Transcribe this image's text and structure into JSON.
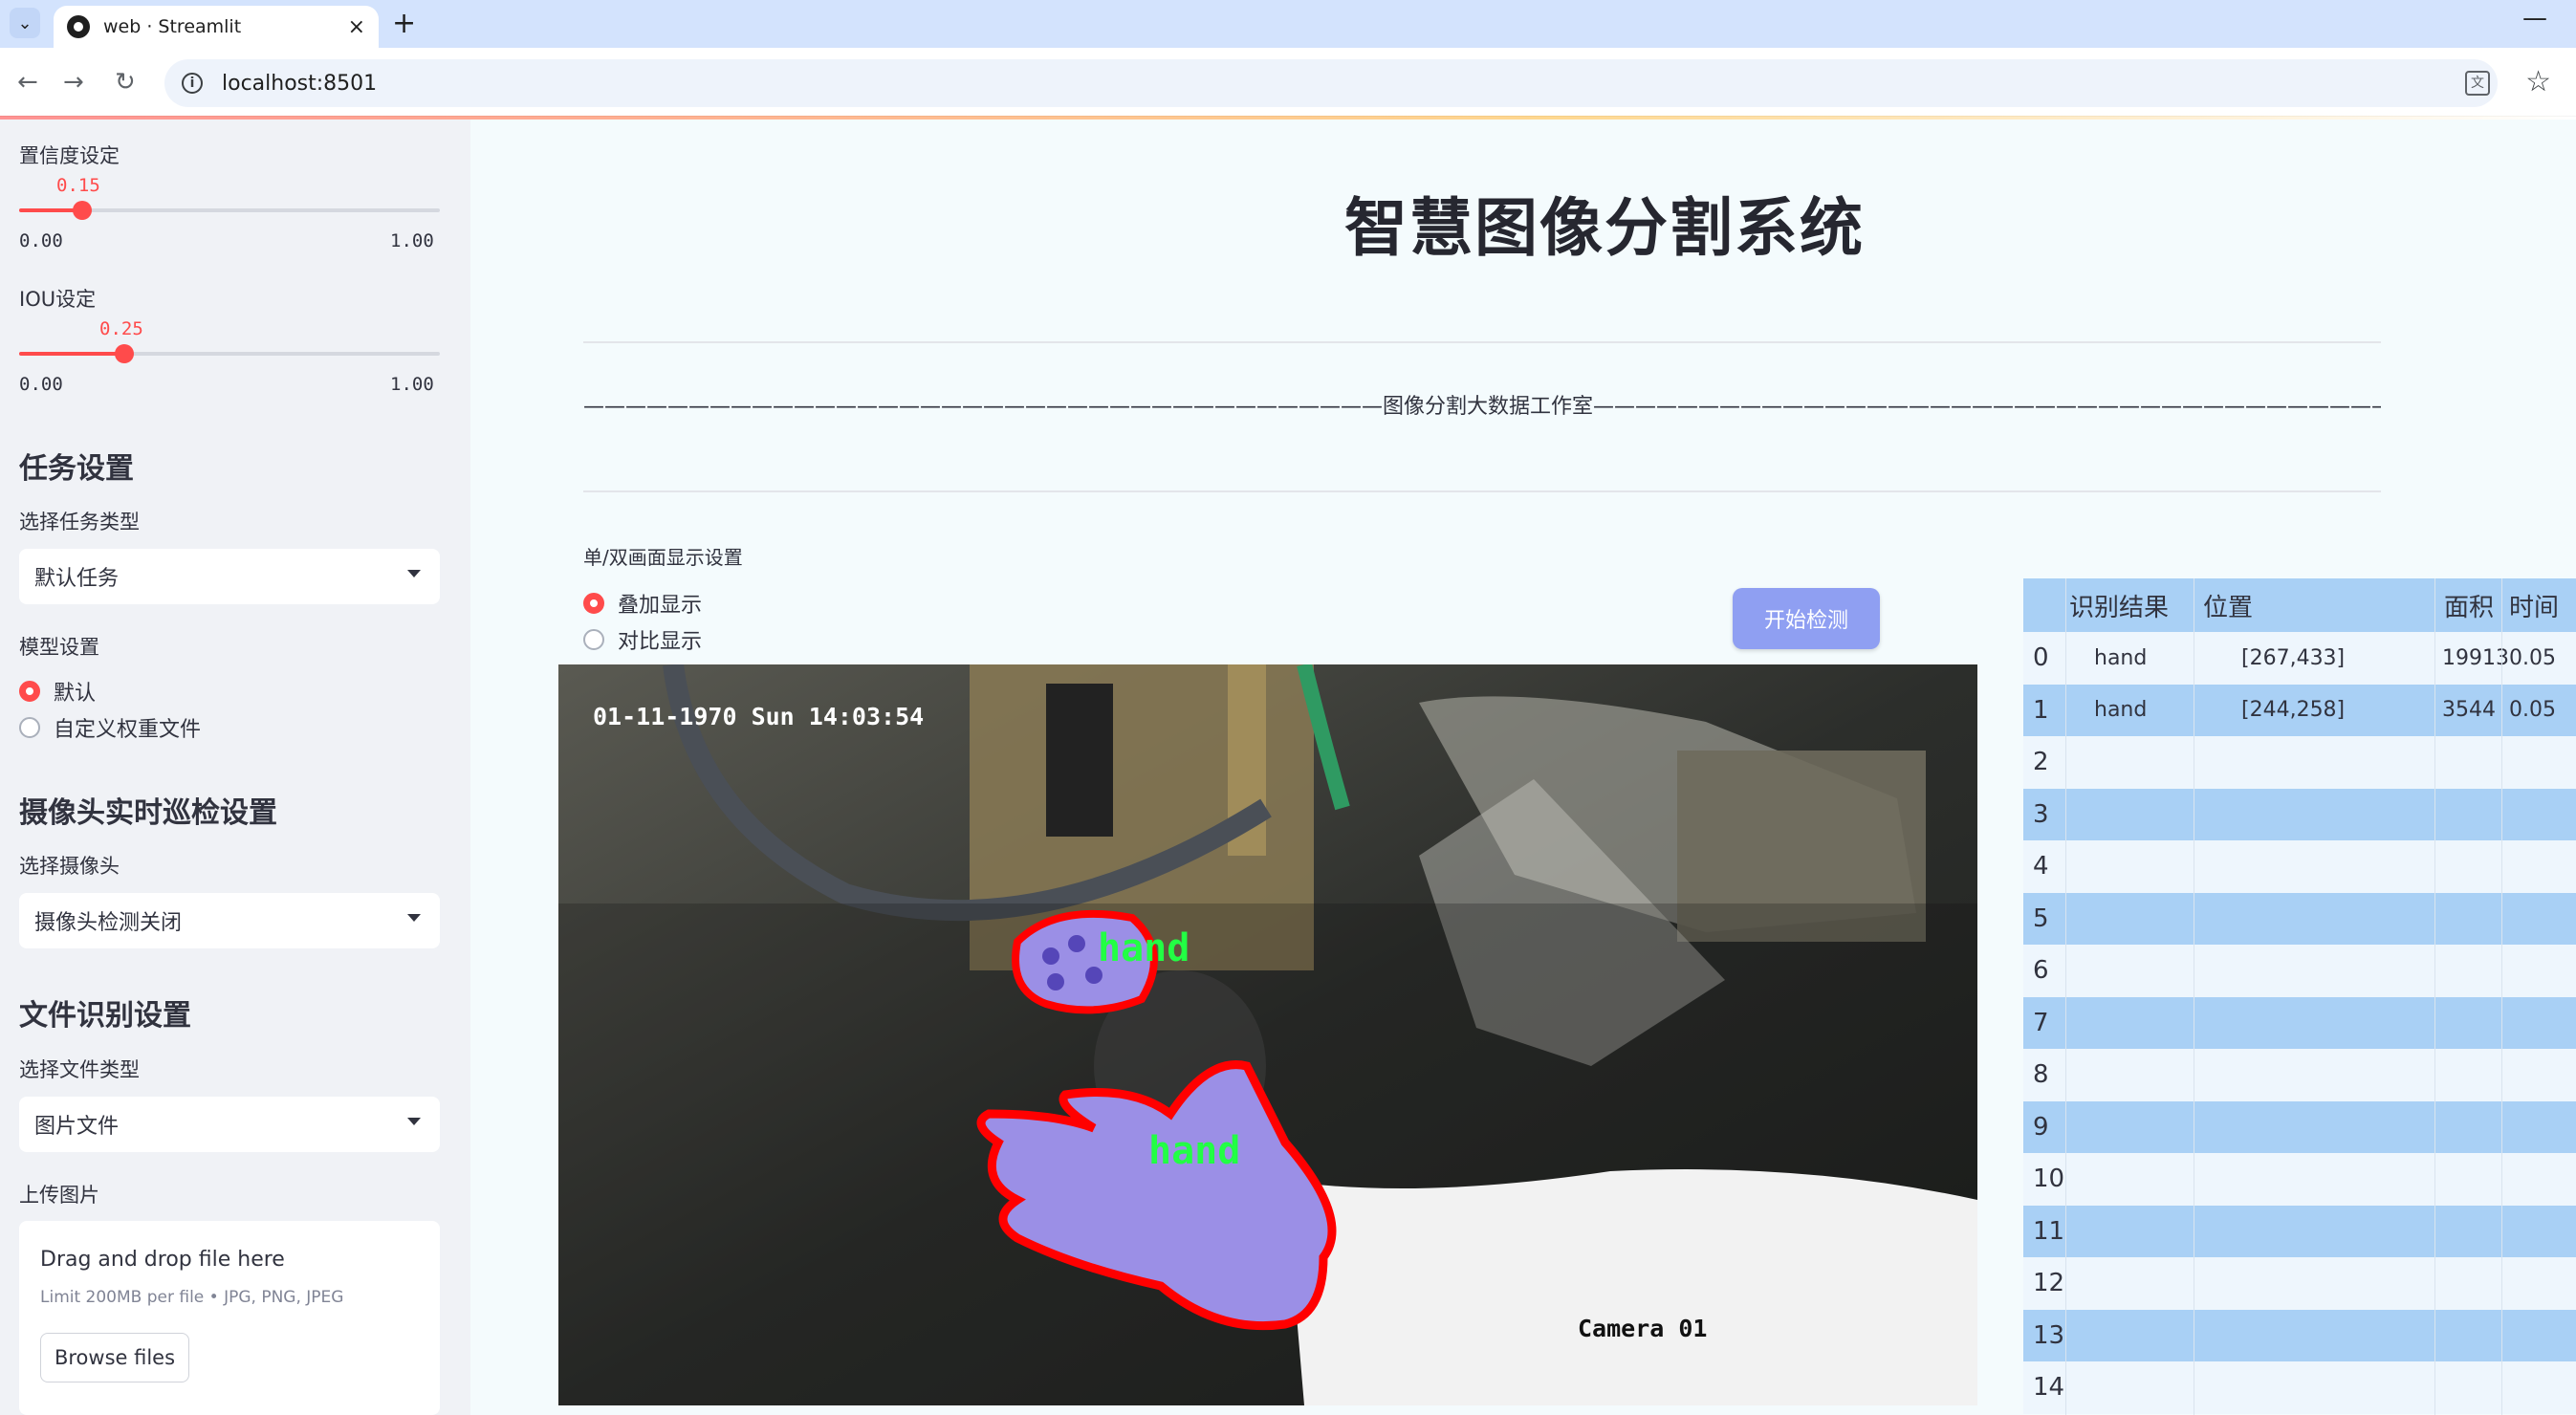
{
  "browser": {
    "tab_title": "web · Streamlit",
    "url": "localhost:8501"
  },
  "sidebar": {
    "confidence": {
      "label": "置信度设定",
      "value": "0.15",
      "min": "0.00",
      "max": "1.00",
      "fraction": 0.15
    },
    "iou": {
      "label": "IOU设定",
      "value": "0.25",
      "min": "0.00",
      "max": "1.00",
      "fraction": 0.25
    },
    "task_heading": "任务设置",
    "task_type_label": "选择任务类型",
    "task_type_value": "默认任务",
    "model_label": "模型设置",
    "model_options": [
      "默认",
      "自定义权重文件"
    ],
    "model_selected": 0,
    "camera_heading": "摄像头实时巡检设置",
    "camera_label": "选择摄像头",
    "camera_value": "摄像头检测关闭",
    "file_heading": "文件识别设置",
    "file_type_label": "选择文件类型",
    "file_type_value": "图片文件",
    "upload_label": "上传图片",
    "uploader": {
      "title": "Drag and drop file here",
      "limit": "Limit 200MB per file • JPG, PNG, JPEG",
      "button": "Browse files"
    }
  },
  "main": {
    "title": "智慧图像分割系统",
    "divider_text": "——————————————————————————————————————图像分割大数据工作室——————————————————————————————————————",
    "display_mode_label": "单/双画面显示设置",
    "display_options": [
      "叠加显示",
      "对比显示"
    ],
    "display_selected": 0,
    "start_button": "开始检测",
    "video": {
      "timestamp": "01-11-1970 Sun 14:03:54",
      "camera": "Camera 01",
      "detections": [
        "hand",
        "hand"
      ]
    },
    "table": {
      "columns": [
        "识别结果",
        "位置",
        "面积",
        "时间"
      ],
      "rows": [
        {
          "index": "0",
          "result": "hand",
          "position": "[267,433]",
          "area": "19913",
          "time": "0.05"
        },
        {
          "index": "1",
          "result": "hand",
          "position": "[244,258]",
          "area": "3544",
          "time": "0.05"
        },
        {
          "index": "2"
        },
        {
          "index": "3"
        },
        {
          "index": "4"
        },
        {
          "index": "5"
        },
        {
          "index": "6"
        },
        {
          "index": "7"
        },
        {
          "index": "8"
        },
        {
          "index": "9"
        },
        {
          "index": "10"
        },
        {
          "index": "11"
        },
        {
          "index": "12"
        },
        {
          "index": "13"
        },
        {
          "index": "14"
        }
      ]
    }
  },
  "colors": {
    "accent": "#ff4b4b",
    "sidebar_bg": "#f0f2f6",
    "main_bg": "#f4fbfd",
    "table_band": "#a9d0f5",
    "button": "#8f9ff2",
    "mask_fill": "#9b8fe6",
    "mask_outline": "#ff0000",
    "label_green": "#22ff44"
  }
}
